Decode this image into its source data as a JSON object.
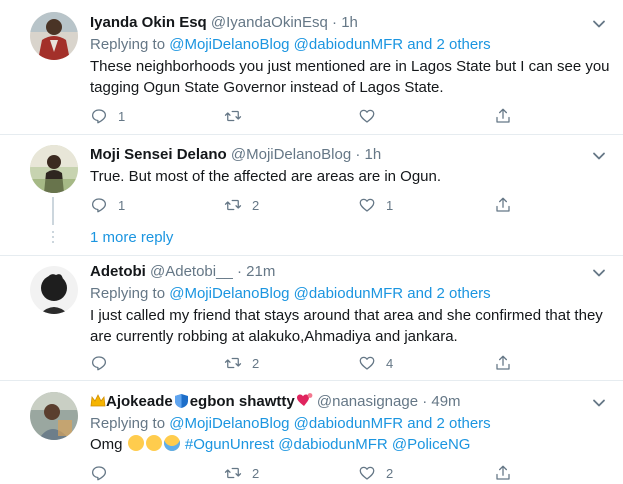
{
  "tweets": [
    {
      "name": "Iyanda Okin Esq",
      "handle": "@IyandaOkinEsq",
      "time": "1h",
      "replying_prefix": "Replying to",
      "replying_to": "@MojiDelanoBlog @dabiodunMFR and 2 others",
      "text": "These neighborhoods you just mentioned are in Lagos State but I can see you tagging Ogun State Governor instead of Lagos State.",
      "reply_count": "1",
      "retweet_count": "",
      "like_count": ""
    },
    {
      "name": "Moji Sensei Delano",
      "handle": "@MojiDelanoBlog",
      "time": "1h",
      "text": "True. But most of the affected are areas are in Ogun.",
      "reply_count": "1",
      "retweet_count": "2",
      "like_count": "1"
    },
    {
      "name": "Adetobi",
      "handle": "@Adetobi__",
      "time": "21m",
      "replying_prefix": "Replying to",
      "replying_to": "@MojiDelanoBlog @dabiodunMFR and 2 others",
      "text": "I just called my friend that stays around that area and she confirmed that they are currently robbing at alakuko,Ahmadiya and jankara.",
      "reply_count": "",
      "retweet_count": "2",
      "like_count": "4"
    },
    {
      "name_part1": "Ajokeade",
      "name_part2": "egbon shawtty",
      "handle": "@nanasignage",
      "time": "49m",
      "replying_prefix": "Replying to",
      "replying_to": "@MojiDelanoBlog @dabiodunMFR and 2 others",
      "text_prefix": "Omg",
      "hashtag": "#OgunUnrest",
      "mention1": "@dabiodunMFR",
      "mention2": "@PoliceNG",
      "reply_count": "",
      "retweet_count": "2",
      "like_count": "2"
    }
  ],
  "thread": {
    "more_replies": "1 more reply"
  },
  "separator": "·",
  "icons": {
    "reply": "reply-icon",
    "retweet": "retweet-icon",
    "like": "heart-icon",
    "share": "share-icon",
    "more": "chevron-down-icon"
  },
  "colors": {
    "link": "#1b95e0",
    "secondary": "#657786",
    "text": "#14171a",
    "divider": "#e6ecf0"
  }
}
